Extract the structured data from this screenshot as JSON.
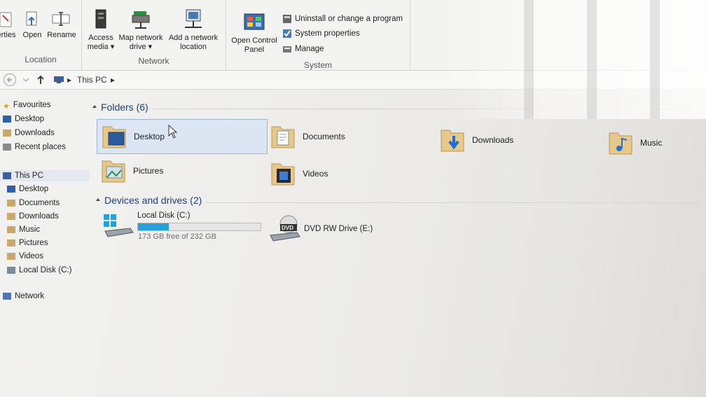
{
  "ribbon": {
    "location": {
      "label": "Location",
      "buttons": [
        {
          "label": "erties"
        },
        {
          "label": "Open"
        },
        {
          "label": "Rename"
        }
      ]
    },
    "network": {
      "label": "Network",
      "access_media": {
        "line1": "Access",
        "line2": "media ▾"
      },
      "map_drive": {
        "line1": "Map network",
        "line2": "drive ▾"
      },
      "add_location": {
        "line1": "Add a network",
        "line2": "location"
      }
    },
    "system": {
      "label": "System",
      "open_cp": {
        "line1": "Open Control",
        "line2": "Panel"
      },
      "uninstall": "Uninstall or change a program",
      "sys_props": "System properties",
      "manage": "Manage"
    }
  },
  "address": {
    "path_item": "This PC"
  },
  "nav": {
    "favourites": "Favourites",
    "fav_items": [
      "Desktop",
      "Downloads",
      "Recent places"
    ],
    "this_pc": "This PC",
    "pc_items": [
      "Desktop",
      "Documents",
      "Downloads",
      "Music",
      "Pictures",
      "Videos",
      "Local Disk (C:)"
    ],
    "network": "Network"
  },
  "content": {
    "folders_header": "Folders (6)",
    "folders": [
      "Desktop",
      "Documents",
      "Downloads",
      "Music",
      "Pictures",
      "Videos"
    ],
    "devices_header": "Devices and drives (2)",
    "drive_c": {
      "name": "Local Disk (C:)",
      "free": "173 GB free of 232 GB",
      "used_fraction": 0.254
    },
    "drive_e": {
      "name": "DVD RW Drive (E:)",
      "badge": "DVD"
    }
  },
  "colors": {
    "accent": "#1e3f7a",
    "selection": "#dbe6f2",
    "drive_fill": "#26a0da"
  }
}
